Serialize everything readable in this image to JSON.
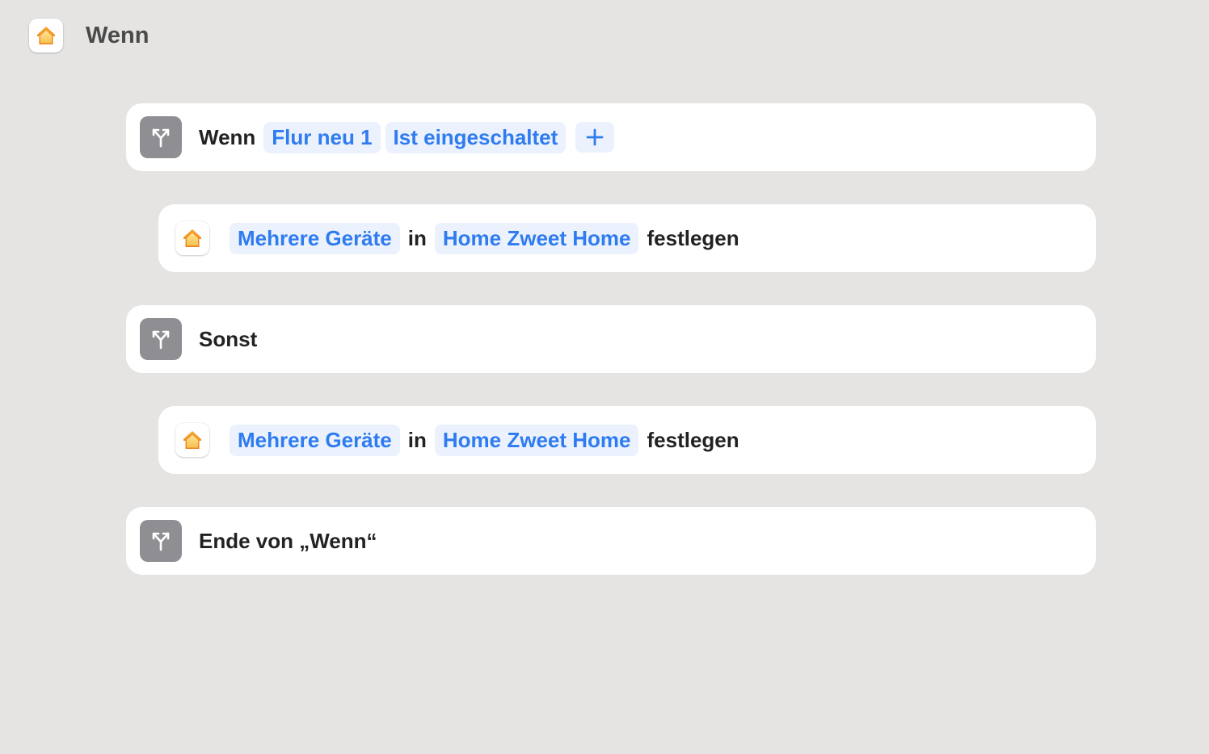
{
  "header": {
    "title": "Wenn"
  },
  "blocks": [
    {
      "kind": "if",
      "icon": "branch-icon",
      "label": "Wenn",
      "condition_device": "Flur neu 1",
      "condition_state": "Ist eingeschaltet",
      "add_label": "+"
    },
    {
      "kind": "action",
      "icon": "home-app-icon",
      "devices": "Mehrere Geräte",
      "in_label": "in",
      "home": "Home Zweet Home",
      "verb": "festlegen"
    },
    {
      "kind": "otherwise",
      "icon": "branch-icon",
      "label": "Sonst"
    },
    {
      "kind": "action",
      "icon": "home-app-icon",
      "devices": "Mehrere Geräte",
      "in_label": "in",
      "home": "Home Zweet Home",
      "verb": "festlegen"
    },
    {
      "kind": "end-if",
      "icon": "branch-icon",
      "label": "Ende von „Wenn“"
    }
  ],
  "colors": {
    "background": "#e5e4e2",
    "card": "#ffffff",
    "token_text": "#2f7bf0",
    "token_bg": "#ebf2fd",
    "scripting_icon_bg": "#8e8e93"
  }
}
